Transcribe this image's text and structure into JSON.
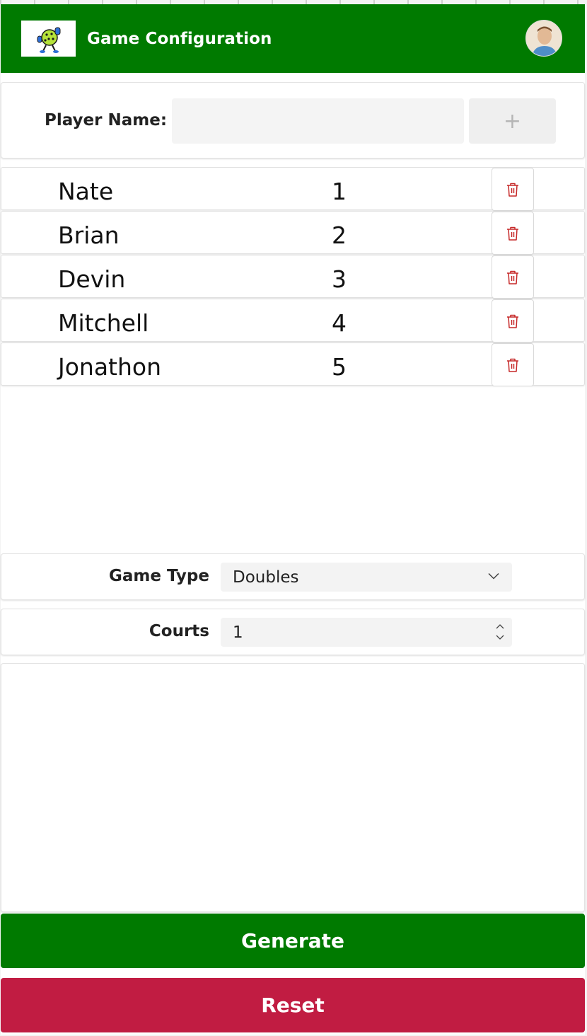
{
  "header": {
    "title": "Game Configuration",
    "logo_icon": "pickleball-logo-icon",
    "avatar_icon": "user-avatar"
  },
  "entry": {
    "label": "Player Name:",
    "input_value": "",
    "placeholder": "",
    "add_label": "+"
  },
  "players": [
    {
      "name": "Nate",
      "number": "1"
    },
    {
      "name": "Brian",
      "number": "2"
    },
    {
      "name": "Devin",
      "number": "3"
    },
    {
      "name": "Mitchell",
      "number": "4"
    },
    {
      "name": "Jonathon",
      "number": "5"
    }
  ],
  "settings": {
    "game_type_label": "Game Type",
    "game_type_value": "Doubles",
    "courts_label": "Courts",
    "courts_value": "1"
  },
  "actions": {
    "generate_label": "Generate",
    "reset_label": "Reset"
  },
  "colors": {
    "primary_green": "#007a00",
    "reset_red": "#c11c42",
    "trash_red": "#c62828"
  }
}
